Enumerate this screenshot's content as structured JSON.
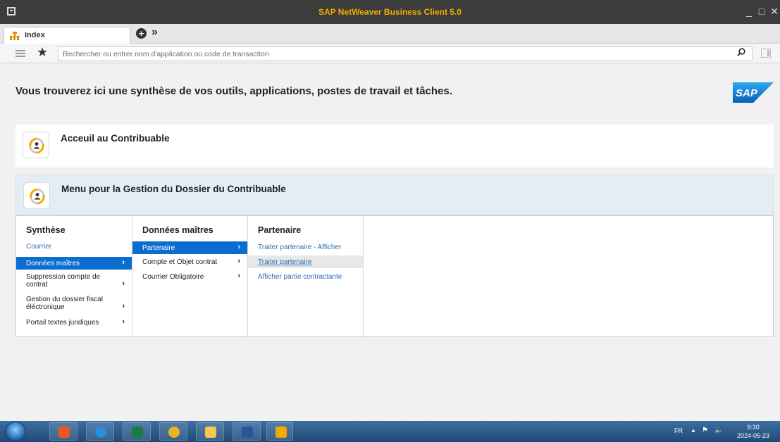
{
  "window": {
    "title": "SAP NetWeaver Business Client 5.0"
  },
  "tabs": [
    {
      "label": "Index"
    }
  ],
  "search": {
    "placeholder": "Rechercher ou entrer nom d'application ou code de transaction"
  },
  "headline": "Vous trouverez ici une synthèse de vos outils, applications, postes de travail et tâches.",
  "cards": [
    {
      "title": "Acceuil au Contribuable"
    },
    {
      "title": "Menu pour la Gestion du Dossier du Contribuable"
    }
  ],
  "menu": {
    "synthese": {
      "title": "Synthèse",
      "items": [
        {
          "label": "Courrier"
        },
        {
          "label": "Données maîtres"
        },
        {
          "label": "Suppression compte de contrat"
        },
        {
          "label": "Gestion du dossier fiscal éléctronique"
        },
        {
          "label": "Portail textes juridiques"
        }
      ]
    },
    "donnees": {
      "title": "Données maîtres",
      "items": [
        {
          "label": "Partenaire"
        },
        {
          "label": "Compte et Objet contrat"
        },
        {
          "label": "Courrier Obligatoire"
        }
      ]
    },
    "partenaire": {
      "title": "Partenaire",
      "items": [
        {
          "label": "Traiter partenaire - Afficher"
        },
        {
          "label": "Traiter partenaire"
        },
        {
          "label": "Afficher partie contractante"
        }
      ]
    }
  },
  "taskbar": {
    "language": "FR",
    "time": "9:30",
    "date": "2024-05-23"
  },
  "colors": {
    "accent": "#0a6ed1",
    "title_text": "#f0ab00",
    "sap_blue": "#1a8de1"
  }
}
